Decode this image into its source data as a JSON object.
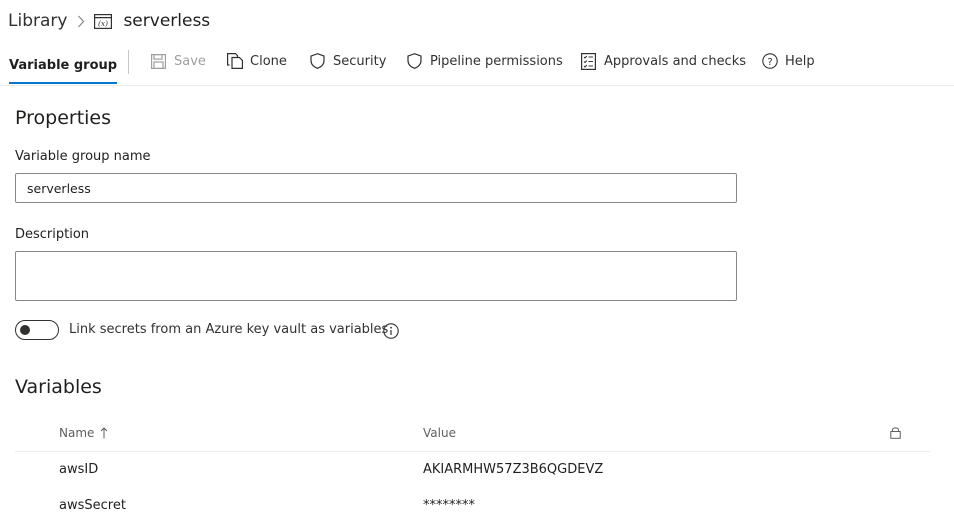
{
  "breadcrumb": {
    "root": "Library",
    "current": "serverless",
    "group_icon": "variable-group-icon"
  },
  "toolbar": {
    "active_tab": "Variable group",
    "save": "Save",
    "clone": "Clone",
    "security": "Security",
    "pipeline_permissions": "Pipeline permissions",
    "approvals": "Approvals and checks",
    "help": "Help"
  },
  "properties": {
    "title": "Properties",
    "name_label": "Variable group name",
    "name_value": "serverless",
    "description_label": "Description",
    "description_value": "",
    "toggle_label": "Link secrets from an Azure key vault as variables",
    "toggle_on": false
  },
  "variables": {
    "title": "Variables",
    "col_name": "Name",
    "col_value": "Value",
    "sort_icon": "arrow-up-icon",
    "lock_icon": "lock-icon",
    "rows": [
      {
        "name": "awsID",
        "value": "AKIARMHW57Z3B6QGDEVZ"
      },
      {
        "name": "awsSecret",
        "value": "********"
      }
    ]
  },
  "colors": {
    "accent": "#0078d4",
    "text": "#323130",
    "disabled": "#a19f9d",
    "border": "#8a8886"
  }
}
